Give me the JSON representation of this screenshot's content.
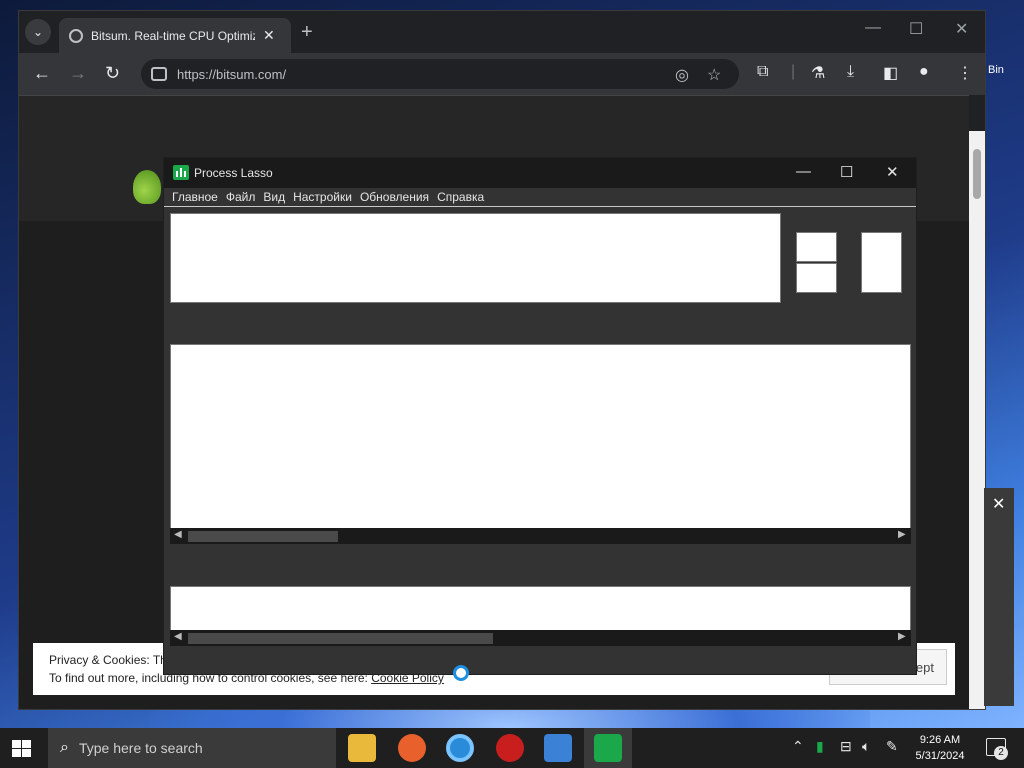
{
  "desktop": {
    "label_right": "Bin"
  },
  "browser": {
    "tab_title": "Bitsum. Real-time CPU Optimiz",
    "url": "https://bitsum.com/"
  },
  "cookie": {
    "line1": "Privacy & Cookies: Th",
    "line2": "To find out more, including how to control cookies, see here:",
    "link": "Cookie Policy",
    "button": "ept"
  },
  "lasso": {
    "title": "Process Lasso",
    "menu": [
      "Главное",
      "Файл",
      "Вид",
      "Настройки",
      "Обновления",
      "Справка"
    ]
  },
  "taskbar": {
    "search_placeholder": "Type here to search",
    "time": "9:26 AM",
    "date": "5/31/2024",
    "notifications": "2"
  }
}
